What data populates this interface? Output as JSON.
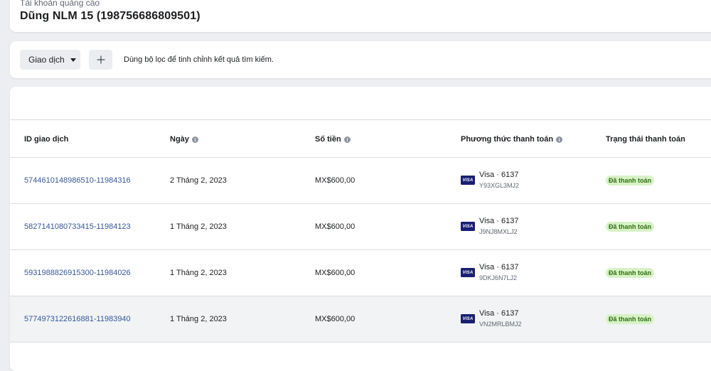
{
  "account": {
    "label": "Tài khoản quảng cáo",
    "name": "Dũng NLM 15 (198756686809501)"
  },
  "filter": {
    "dropdown_label": "Giao dịch",
    "add_icon": "plus-icon",
    "hint": "Dùng bộ lọc để tinh chỉnh kết quả tìm kiếm."
  },
  "table": {
    "columns": [
      {
        "label": "ID giao dịch",
        "info": false
      },
      {
        "label": "Ngày",
        "info": true
      },
      {
        "label": "Số tiền",
        "info": true
      },
      {
        "label": "Phương thức thanh toán",
        "info": true
      },
      {
        "label": "Trạng thái thanh toán",
        "info": false
      }
    ],
    "rows": [
      {
        "id": "5744610148986510-11984316",
        "date": "2 Tháng 2, 2023",
        "amount": "MX$600,00",
        "card_brand": "VISA",
        "method": "Visa · 6137",
        "reference": "Y93XGL3MJ2",
        "status": "Đã thanh toán"
      },
      {
        "id": "5827141080733415-11984123",
        "date": "1 Tháng 2, 2023",
        "amount": "MX$600,00",
        "card_brand": "VISA",
        "method": "Visa · 6137",
        "reference": "J9NJ8MXLJ2",
        "status": "Đã thanh toán"
      },
      {
        "id": "5931988826915300-11984026",
        "date": "1 Tháng 2, 2023",
        "amount": "MX$600,00",
        "card_brand": "VISA",
        "method": "Visa · 6137",
        "reference": "9DKJ6N7LJ2",
        "status": "Đã thanh toán"
      },
      {
        "id": "5774973122616881-11983940",
        "date": "1 Tháng 2, 2023",
        "amount": "MX$600,00",
        "card_brand": "VISA",
        "method": "Visa · 6137",
        "reference": "VN2MRLBMJ2",
        "status": "Đã thanh toán"
      }
    ]
  },
  "colors": {
    "background": "#eceef1",
    "link": "#385898",
    "status_badge_bg": "#d7f2c6",
    "status_badge_text": "#2f6e12",
    "visa_blue": "#1a1f71"
  }
}
